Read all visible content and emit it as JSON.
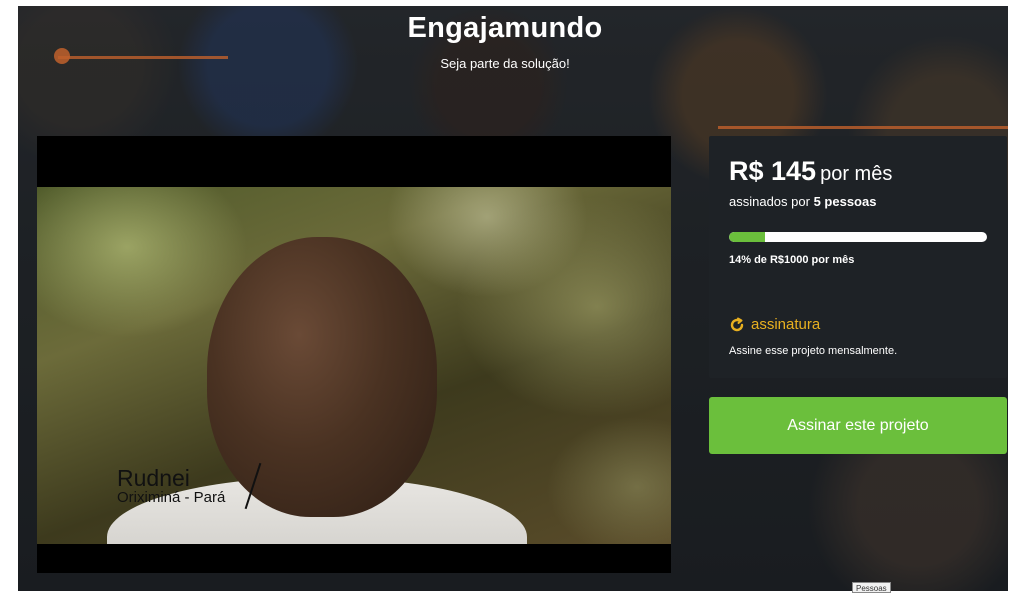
{
  "header": {
    "title": "Engajamundo",
    "subtitle": "Seja parte da solução!"
  },
  "video": {
    "caption_name": "Rudnei",
    "caption_place": "Oriximiná - Pará"
  },
  "funding": {
    "amount": "R$ 145",
    "period": "por mês",
    "signed_prefix": "assinados por",
    "signed_count": "5 pessoas",
    "progress_percent": 14,
    "progress_text": "14% de R$1000 por mês",
    "subscription_label": "assinatura",
    "subscription_desc": "Assine esse projeto mensalmente.",
    "subscription_icon": "refresh-icon"
  },
  "cta": {
    "label": "Assinar este projeto"
  },
  "tooltip": {
    "text": "Pessoas"
  },
  "colors": {
    "accent_green": "#6bbf3c",
    "accent_gold": "#e8b020",
    "panel_bg": "#1e2226"
  }
}
